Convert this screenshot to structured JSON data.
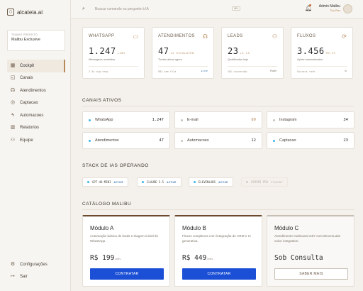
{
  "app": {
    "name": "alcateia.ai"
  },
  "tenant": {
    "label": "TENANT PREFEITO",
    "name": "Malibu Exclusive"
  },
  "nav": {
    "items": [
      {
        "label": "Cockpit",
        "icon": "grid-icon",
        "glyph": "▦"
      },
      {
        "label": "Canais",
        "icon": "chat-icon",
        "glyph": "◱"
      },
      {
        "label": "Atendimentos",
        "icon": "headset-icon",
        "glyph": "☊"
      },
      {
        "label": "Captacao",
        "icon": "target-icon",
        "glyph": "◎"
      },
      {
        "label": "Automacoes",
        "icon": "bolt-icon",
        "glyph": "ϟ"
      },
      {
        "label": "Relatorios",
        "icon": "bar-chart-icon",
        "glyph": "▥"
      },
      {
        "label": "Equipe",
        "icon": "users-icon",
        "glyph": "⚇"
      }
    ],
    "bottom": [
      {
        "label": "Configurações",
        "icon": "gear-icon",
        "glyph": "⚙"
      },
      {
        "label": "Sair",
        "icon": "logout-icon",
        "glyph": "↦"
      }
    ]
  },
  "topbar": {
    "search_placeholder": "Buscar comando ou pergunte à IA",
    "shortcut": "⌘K",
    "user_name": "Admin Malibu",
    "user_role": "Tiny Plan"
  },
  "kpis": [
    {
      "title": "WHATSAPP",
      "value": "1.247",
      "delta": "+18%",
      "sub": "Mensagens recebidas",
      "foot": "2.3s avg resp.",
      "foot_right": "",
      "icon": "message-icon",
      "glyph": "▭"
    },
    {
      "title": "ATENDIMENTOS",
      "value": "47",
      "delta": "12 ESCALATED",
      "sub": "Tickets ativos agora",
      "foot": "98% sem fila",
      "foot_right": "● Live",
      "icon": "headset-icon",
      "glyph": "☊"
    },
    {
      "title": "LEADS",
      "value": "23",
      "delta": "+3 1h",
      "sub": "Qualificados hoje",
      "foot": "18% conversão",
      "foot_right": "Funil ›",
      "icon": "add-user-icon",
      "glyph": "⚇"
    },
    {
      "title": "FLUXOS",
      "value": "3.456",
      "delta": "99.2%",
      "sub": "Ações automatizadas",
      "foot": "Success rate",
      "foot_right": "⊙",
      "icon": "workflow-icon",
      "glyph": "⟳"
    }
  ],
  "channels_section": {
    "title": "CANAIS ATIVOS"
  },
  "channels": [
    {
      "name": "WhatsApp",
      "count": "1.247",
      "color": "#3fb6e8"
    },
    {
      "name": "E-mail",
      "count": "89",
      "color": "#c9c2b8"
    },
    {
      "name": "Instagram",
      "count": "34",
      "color": "#c9c2b8"
    },
    {
      "name": "Atendimentos",
      "count": "47",
      "color": "#3fb6e8"
    },
    {
      "name": "Automacoes",
      "count": "12",
      "color": "#c9c2b8"
    },
    {
      "name": "Captacao",
      "count": "23",
      "color": "#3fb6e8"
    }
  ],
  "stack_section": {
    "title": "STACK DE IAS OPERANDO"
  },
  "stack": [
    {
      "name": "GPT-4O-MINI",
      "status": "ACTIVE",
      "color": "#3fb6e8"
    },
    {
      "name": "CLAUDE 3.5",
      "status": "ACTIVE",
      "color": "#3fb6e8"
    },
    {
      "name": "ELEVENLABS",
      "status": "ACTIVE",
      "color": "#3fb6e8"
    },
    {
      "name": "GEMINI PRO",
      "status": "STANDBY",
      "color": "#d4cec5"
    }
  ],
  "catalog_section": {
    "title": "CATÁLOGO MALIBU"
  },
  "modules": [
    {
      "name": "Módulo A",
      "desc": "Automação básica de leads e triagem inicial de WhatsApp.",
      "price": "R$ 199",
      "period": "/mês",
      "button": "CONTRATAR"
    },
    {
      "name": "Módulo B",
      "desc": "Fluxos complexos com integração de CRM e IA generativa.",
      "price": "R$ 449",
      "period": "/mês",
      "button": "CONTRATAR"
    },
    {
      "name": "Módulo C",
      "desc": "Atendimento multicanal 24/7 com ElevenLabs voice integration.",
      "price": "Sob Consulta",
      "period": "",
      "button": "SABER MAIS"
    }
  ]
}
